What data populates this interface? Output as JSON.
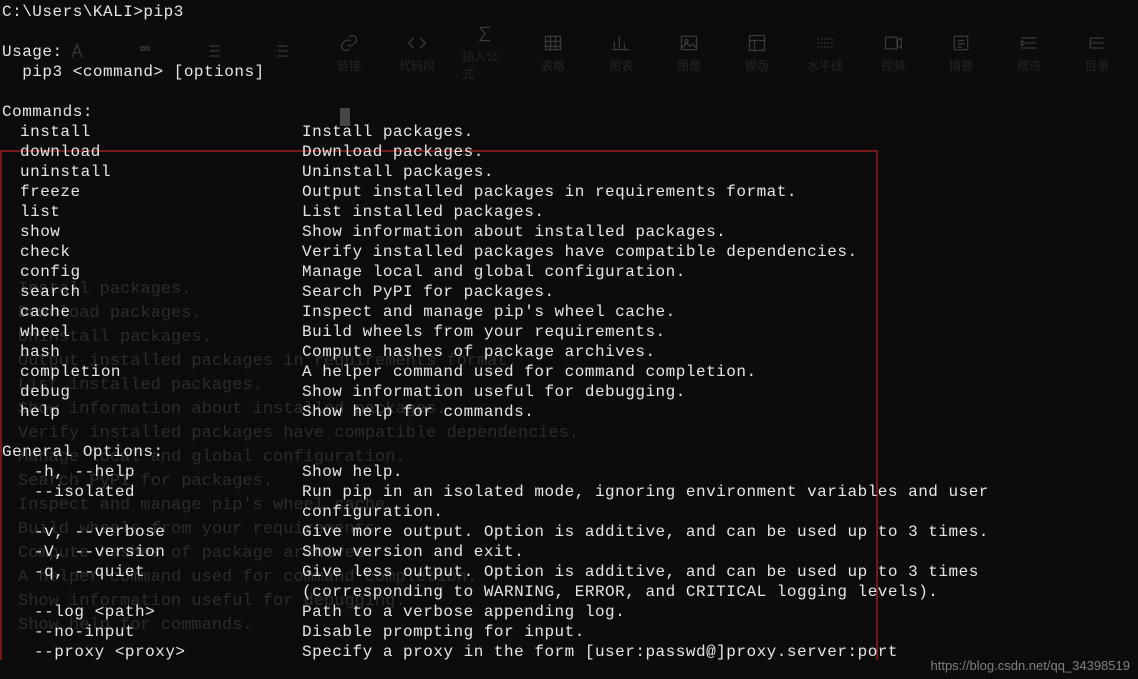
{
  "prompt": "C:\\Users\\KALI>pip3",
  "usage_header": "Usage:",
  "usage_line": "  pip3 <command> [options]",
  "commands_header": "Commands:",
  "commands": [
    {
      "name": "install",
      "desc": "Install packages."
    },
    {
      "name": "download",
      "desc": "Download packages."
    },
    {
      "name": "uninstall",
      "desc": "Uninstall packages."
    },
    {
      "name": "freeze",
      "desc": "Output installed packages in requirements format."
    },
    {
      "name": "list",
      "desc": "List installed packages."
    },
    {
      "name": "show",
      "desc": "Show information about installed packages."
    },
    {
      "name": "check",
      "desc": "Verify installed packages have compatible dependencies."
    },
    {
      "name": "config",
      "desc": "Manage local and global configuration."
    },
    {
      "name": "search",
      "desc": "Search PyPI for packages."
    },
    {
      "name": "cache",
      "desc": "Inspect and manage pip's wheel cache."
    },
    {
      "name": "wheel",
      "desc": "Build wheels from your requirements."
    },
    {
      "name": "hash",
      "desc": "Compute hashes of package archives."
    },
    {
      "name": "completion",
      "desc": "A helper command used for command completion."
    },
    {
      "name": "debug",
      "desc": "Show information useful for debugging."
    },
    {
      "name": "help",
      "desc": "Show help for commands."
    }
  ],
  "options_header": "General Options:",
  "options": [
    {
      "flag": "-h, --help",
      "desc": "Show help."
    },
    {
      "flag": "--isolated",
      "desc": "Run pip in an isolated mode, ignoring environment variables and user",
      "cont": "configuration."
    },
    {
      "flag": "-v, --verbose",
      "desc": "Give more output. Option is additive, and can be used up to 3 times."
    },
    {
      "flag": "-V, --version",
      "desc": "Show version and exit."
    },
    {
      "flag": "-q, --quiet",
      "desc": "Give less output. Option is additive, and can be used up to 3 times",
      "cont": "(corresponding to WARNING, ERROR, and CRITICAL logging levels)."
    },
    {
      "flag": "--log <path>",
      "desc": "Path to a verbose appending log."
    },
    {
      "flag": "--no-input",
      "desc": "Disable prompting for input."
    },
    {
      "flag": "--proxy <proxy>",
      "desc": "Specify a proxy in the form [user:passwd@]proxy.server:port"
    }
  ],
  "ghost_lines": [
    "Install packages.",
    "Download packages.",
    "Uninstall packages.",
    "Output installed packages in requirements format.",
    "List installed packages.",
    "Show information about installed packages.",
    "Verify installed packages have compatible dependencies.",
    "Manage local and global configuration.",
    "Search PyPI for packages.",
    "Inspect and manage pip's wheel cache.",
    "Build wheels from your requirements.",
    "Compute hashes of package archives.",
    "A helper command used for command completion.",
    "Show information useful for debugging.",
    "Show help for commands."
  ],
  "toolbar": [
    {
      "label": "链接",
      "icon": "link"
    },
    {
      "label": "代码段",
      "icon": "code"
    },
    {
      "label": "插入公式",
      "icon": "sigma"
    },
    {
      "label": "表格",
      "icon": "table"
    },
    {
      "label": "图表",
      "icon": "chart"
    },
    {
      "label": "图像",
      "icon": "image"
    },
    {
      "label": "模版",
      "icon": "template"
    },
    {
      "label": "水平线",
      "icon": "hr"
    },
    {
      "label": "视频",
      "icon": "video"
    },
    {
      "label": "摘要",
      "icon": "summary"
    },
    {
      "label": "缩进",
      "icon": "indent"
    },
    {
      "label": "目录",
      "icon": "toc"
    }
  ],
  "watermark": "https://blog.csdn.net/qq_34398519"
}
